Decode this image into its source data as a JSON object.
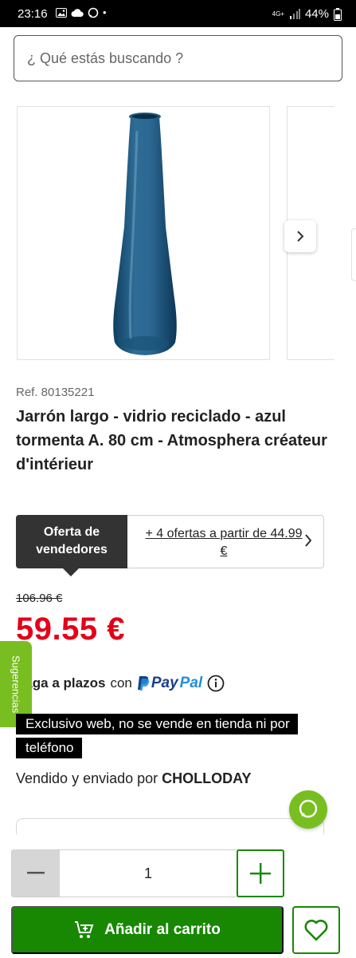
{
  "status_bar": {
    "time": "23:16",
    "dot": "•",
    "network": "4G+",
    "battery": "44%",
    "left_icons": [
      "image-icon",
      "cloud-icon",
      "chat-bubble-icon"
    ],
    "right_icons": [
      "data-arrows-icon",
      "signal-icon",
      "battery-icon"
    ]
  },
  "search": {
    "placeholder": "¿ Qué estás buscando ?"
  },
  "product": {
    "ref": "Ref. 80135221",
    "title": "Jarrón largo - vidrio reciclado - azul tormenta A. 80 cm - Atmosphera créateur d'intérieur",
    "image_alt": "blue-glass-vase"
  },
  "offers": {
    "tab_label": "Oferta de vendedores",
    "link_text": "+ 4 ofertas a partir de 44.99 €"
  },
  "price": {
    "old": "106.96 €",
    "current": "59.55 €"
  },
  "sugerencias_label": "Sugerencias",
  "paypal": {
    "lead": "Paga a plazos",
    "connector": "con",
    "brand_part1": "Pay",
    "brand_part2": "Pal"
  },
  "exclusive_note": "Exclusivo web, no se vende en tienda ni por teléfono",
  "seller": {
    "prefix": "Vendido y enviado por",
    "name": "CHOLLODAY"
  },
  "quantity": {
    "value": "1"
  },
  "add_to_cart_label": "Añadir al carrito",
  "colors": {
    "green": "#188803",
    "light_green": "#78be20",
    "price_red": "#e2001a",
    "dark_tab": "#333333"
  }
}
